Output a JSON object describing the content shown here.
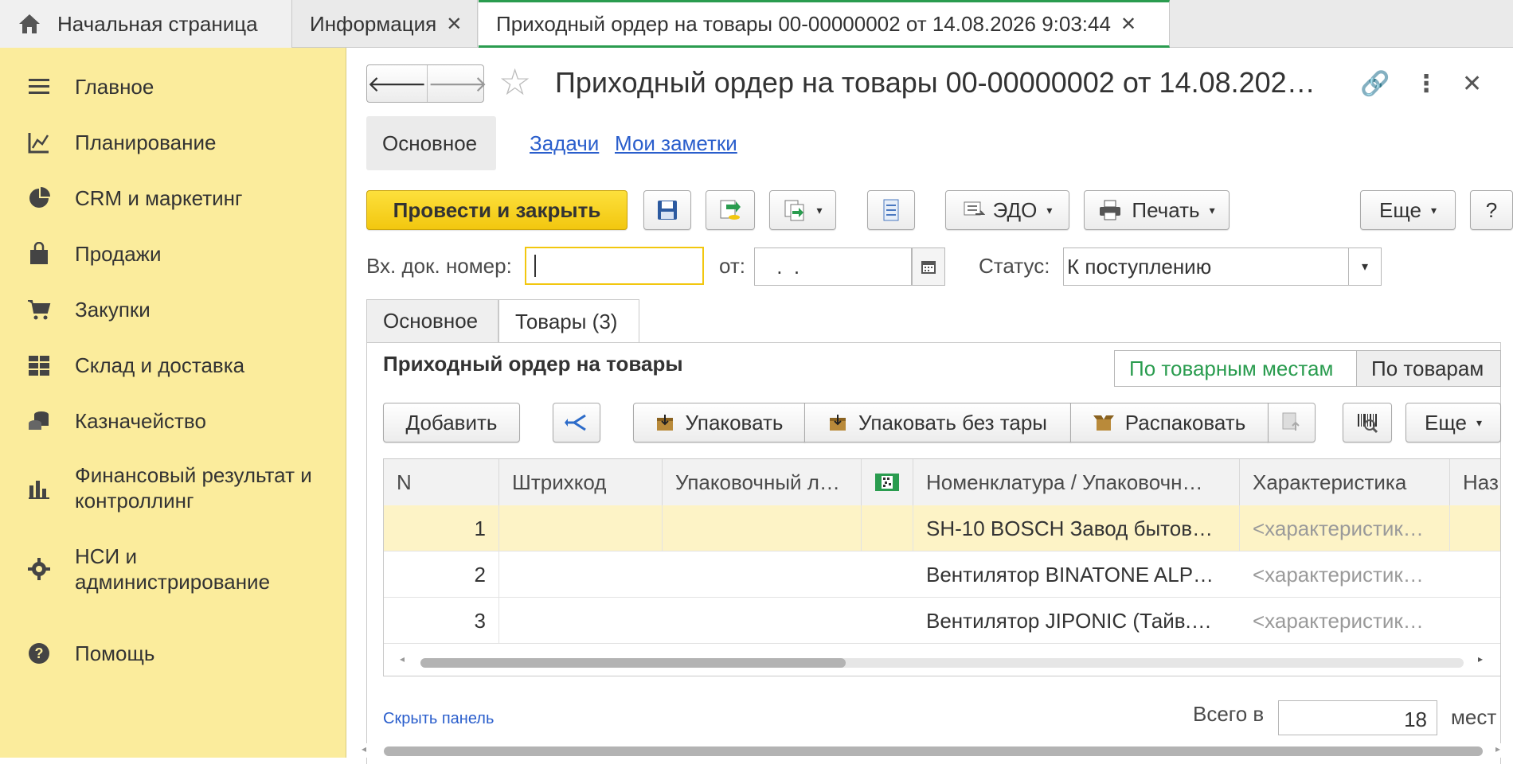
{
  "tabs": {
    "home": "Начальная страница",
    "info": "Информация",
    "active": "Приходный ордер на товары 00-00000002 от 14.08.2026 9:03:44"
  },
  "sidebar": {
    "items": [
      {
        "label": "Главное",
        "icon": "menu-icon"
      },
      {
        "label": "Планирование",
        "icon": "planning-icon"
      },
      {
        "label": "CRM и маркетинг",
        "icon": "pie-chart-icon"
      },
      {
        "label": "Продажи",
        "icon": "shopping-bag-icon"
      },
      {
        "label": "Закупки",
        "icon": "cart-icon"
      },
      {
        "label": "Склад и доставка",
        "icon": "grid-icon"
      },
      {
        "label": "Казначейство",
        "icon": "coins-icon"
      },
      {
        "label": "Финансовый результат и контроллинг",
        "icon": "bar-chart-icon"
      },
      {
        "label": "НСИ и администрирование",
        "icon": "gear-icon"
      },
      {
        "label": "Помощь",
        "icon": "help-icon"
      }
    ]
  },
  "form": {
    "title": "Приходный ордер на товары 00-00000002 от 14.08.202…",
    "subtabs": [
      "Основное",
      "Задачи",
      "Мои заметки"
    ],
    "toolbar": {
      "post_close": "Провести и закрыть",
      "edo": "ЭДО",
      "print": "Печать",
      "more": "Еще",
      "help": "?"
    },
    "fields": {
      "incoming_number_label": "Вх. док. номер:",
      "incoming_number_value": "",
      "from_label": "от:",
      "from_value": " .  .",
      "status_label": "Статус:",
      "status_value": "К поступлению"
    },
    "page_tabs": [
      "Основное",
      "Товары (3)"
    ],
    "panel_title": "Приходный ордер на товары",
    "view_toggle": [
      "По товарным местам",
      "По товарам"
    ],
    "grid_toolbar": {
      "add": "Добавить",
      "pack": "Упаковать",
      "pack_no_tare": "Упаковать без тары",
      "unpack": "Распаковать",
      "more": "Еще"
    },
    "columns": [
      "N",
      "Штрихкод",
      "Упаковочный л…",
      "",
      "Номенклатура / Упаковочн…",
      "Характеристика",
      "Наз"
    ],
    "rows": [
      {
        "n": "1",
        "barcode": "",
        "pack": "",
        "nomenclature": "SH-10 BOSCH Завод бытов…",
        "characteristic": "<характеристик…"
      },
      {
        "n": "2",
        "barcode": "",
        "pack": "",
        "nomenclature": "Вентилятор BINATONE ALP…",
        "characteristic": "<характеристик…"
      },
      {
        "n": "3",
        "barcode": "",
        "pack": "",
        "nomenclature": "Вентилятор JIPONIC (Тайв.…",
        "characteristic": "<характеристик…"
      }
    ],
    "footer": {
      "hide_panel": "Скрыть панель",
      "total_label": "Всего в",
      "total_value": "18",
      "unit": "мест"
    }
  }
}
